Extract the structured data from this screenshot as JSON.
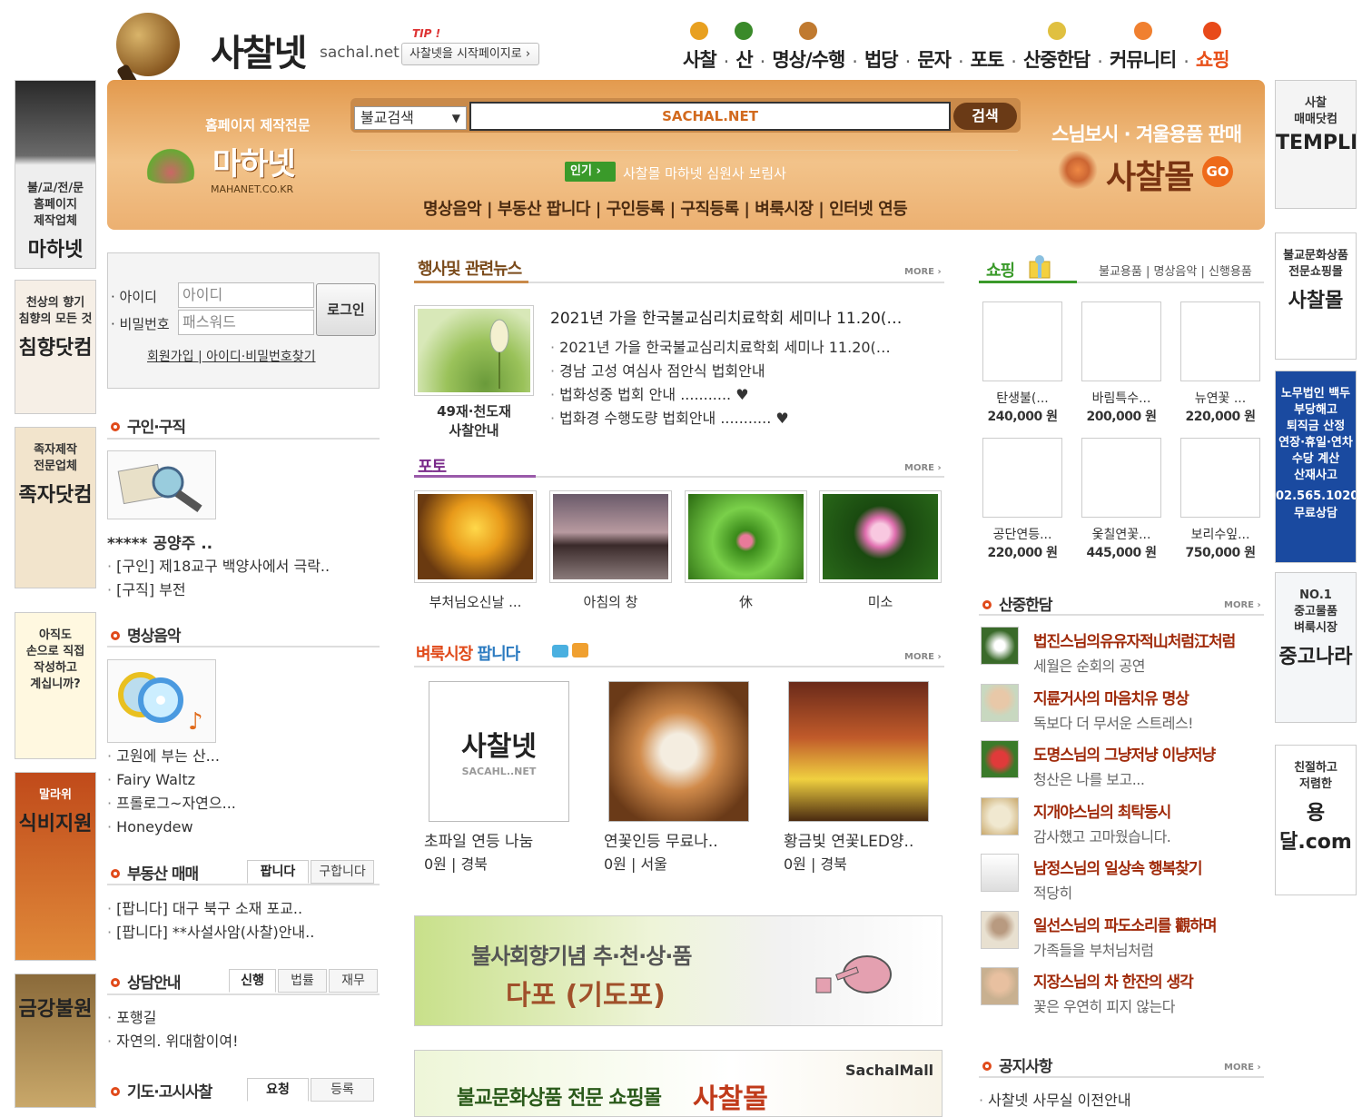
{
  "header": {
    "logo_text": "사찰넷",
    "logo_sub": "sachal.net",
    "tip_label": "TIP !",
    "tip_button": "사찰넷을 시작페이지로 ›",
    "nav": [
      "사찰",
      "산",
      "명상/수행",
      "법당",
      "문자",
      "포토",
      "산중한담",
      "커뮤니티",
      "쇼핑"
    ]
  },
  "banner": {
    "mahanet_sub": "홈페이지 제작전문",
    "mahanet_logo": "마하넷",
    "mahanet_url": "MAHANET.CO.KR",
    "search_select": "불교검색",
    "search_value": "SACHAL.NET",
    "search_button": "검색",
    "popular_badge": "인기 ›",
    "popular_text": "사찰몰 마하넷 심원사 보림사",
    "links": "명상음악 | 부동산 팝니다 | 구인등록 | 구직등록 | 벼룩시장 | 인터넷 연등",
    "sachalmall_title": "스님보시 · 겨울용품 판매",
    "sachalmall_logo": "사찰몰",
    "sachalmall_go": "GO"
  },
  "left_ads": [
    {
      "lines": [
        "불/교/전/문",
        "홈페이지",
        "제작업체"
      ],
      "big": "마하넷"
    },
    {
      "lines": [
        "천상의 향기",
        "침향의 모든 것"
      ],
      "big": "침향닷컴"
    },
    {
      "lines": [
        "족자제작",
        "전문업체"
      ],
      "big": "족자닷컴"
    },
    {
      "lines": [
        "아직도",
        "손으로 직접",
        "작성하고",
        "계십니까?"
      ],
      "big": ""
    },
    {
      "lines": [
        "말라위"
      ],
      "big": "식비지원"
    },
    {
      "lines": [],
      "big": "금강불원"
    }
  ],
  "right_ads": [
    {
      "lines": [
        "사찰",
        "매매닷컴"
      ],
      "big": "TEMPLES"
    },
    {
      "lines": [
        "불교문화상품",
        "전문쇼핑몰"
      ],
      "big": "사찰몰"
    },
    {
      "lines": [
        "노무법인 백두",
        "부당해고",
        "퇴직금 산정",
        "연장·휴일·연차수당 계산",
        "산재사고"
      ],
      "big": "02.565.1020 무료상담"
    },
    {
      "lines": [
        "NO.1",
        "중고물품",
        "벼룩시장"
      ],
      "big": "중고나라"
    },
    {
      "lines": [
        "친절하고",
        "저렴한"
      ],
      "big": "용달.com"
    }
  ],
  "login": {
    "id_label": "· 아이디",
    "pw_label": "· 비밀번호",
    "id_placeholder": "아이디",
    "pw_placeholder": "패스워드",
    "button": "로그인",
    "links": "회원가입 | 아이디·비밀번호찾기"
  },
  "jobs": {
    "title": "구인·구직",
    "featured": "***** 공양주 ..",
    "items": [
      "[구인] 제18교구 백양사에서 극락..",
      "[구직] 부전"
    ]
  },
  "music": {
    "title": "명상음악",
    "items": [
      "고원에 부는 산...",
      "Fairy Waltz",
      "프롤로그~자연으...",
      "Honeydew"
    ]
  },
  "realestate": {
    "title": "부동산 매매",
    "tabs": [
      "팝니다",
      "구합니다"
    ],
    "items": [
      "[팝니다] 대구 북구 소재 포교..",
      "[팝니다] **사설사암(사찰)안내.."
    ]
  },
  "counsel": {
    "title": "상담안내",
    "tabs": [
      "신행",
      "법률",
      "재무"
    ],
    "items": [
      "포행길",
      "자연의. 위대함이여!"
    ]
  },
  "prayer": {
    "title": "기도·고시사찰",
    "tabs": [
      "요청",
      "등록"
    ]
  },
  "news": {
    "title": "행사및 관련뉴스",
    "more": "MORE ›",
    "thumb_caption": "49재·천도재\n사찰안내",
    "main": "2021년 가을 한국불교심리치료학회 세미나 11.20(…",
    "items": [
      "2021년 가을 한국불교심리치료학회 세미나 11.20(…",
      "경남 고성 여심사 점안식 법회안내",
      "법화성중 법회 안내 ........... ♥",
      "법화경 수행도량 법회안내 ........... ♥"
    ]
  },
  "photo": {
    "title": "포토",
    "more": "MORE ›",
    "items": [
      "부처님오신날 ...",
      "아침의 창",
      "休",
      "미소"
    ]
  },
  "market": {
    "title_a": "벼룩시장",
    "title_b": "팝니다",
    "more": "MORE ›",
    "items": [
      {
        "name": "초파일 연등 나눔",
        "meta": "0원 | 경북",
        "logo": "사찰넷",
        "logo_sub": "SACAHL..NET"
      },
      {
        "name": "연꽃인등 무료나..",
        "meta": "0원 | 서울"
      },
      {
        "name": "황금빛 연꽃LED양..",
        "meta": "0원 | 경북"
      }
    ]
  },
  "promo1": {
    "line1": "불사회향기념 추·천·상·품",
    "line2": "다포 (기도포)"
  },
  "promo2": {
    "brand": "SachalMall",
    "text": "불교문화상품 전문 쇼핑몰",
    "logo": "사찰몰"
  },
  "shopping": {
    "title": "쇼핑",
    "tabs": "불교용품 | 명상음악 | 신행용품",
    "items": [
      {
        "name": "탄생불(...",
        "price": "240,000 원"
      },
      {
        "name": "바림특수...",
        "price": "200,000 원"
      },
      {
        "name": "뉴연꽃 ...",
        "price": "220,000 원"
      },
      {
        "name": "공단연등...",
        "price": "220,000 원"
      },
      {
        "name": "옻칠연꽃...",
        "price": "445,000 원"
      },
      {
        "name": "보리수잎...",
        "price": "750,000 원"
      }
    ]
  },
  "talk": {
    "title": "산중한담",
    "more": "MORE ›",
    "items": [
      {
        "title": "법진스님의유유자적山처럼江처럼",
        "sub": "세월은 순회의 공연"
      },
      {
        "title": "지륜거사의 마음치유 명상",
        "sub": "독보다 더 무서운 스트레스!"
      },
      {
        "title": "도명스님의 그냥저냥 이냥저냥",
        "sub": "청산은 나를 보고..."
      },
      {
        "title": "지개야스님의 최탁동시",
        "sub": "감사했고 고마웠습니다."
      },
      {
        "title": "남정스님의 일상속 행복찾기",
        "sub": "적당히"
      },
      {
        "title": "일선스님의 파도소리를 觀하며",
        "sub": "가족들을 부처님처럼"
      },
      {
        "title": "지장스님의 차 한잔의 생각",
        "sub": "꽃은 우연히 피지 않는다"
      }
    ]
  },
  "notice": {
    "title": "공지사항",
    "more": "MORE ›",
    "items": [
      "사찰넷 사무실 이전안내"
    ]
  }
}
